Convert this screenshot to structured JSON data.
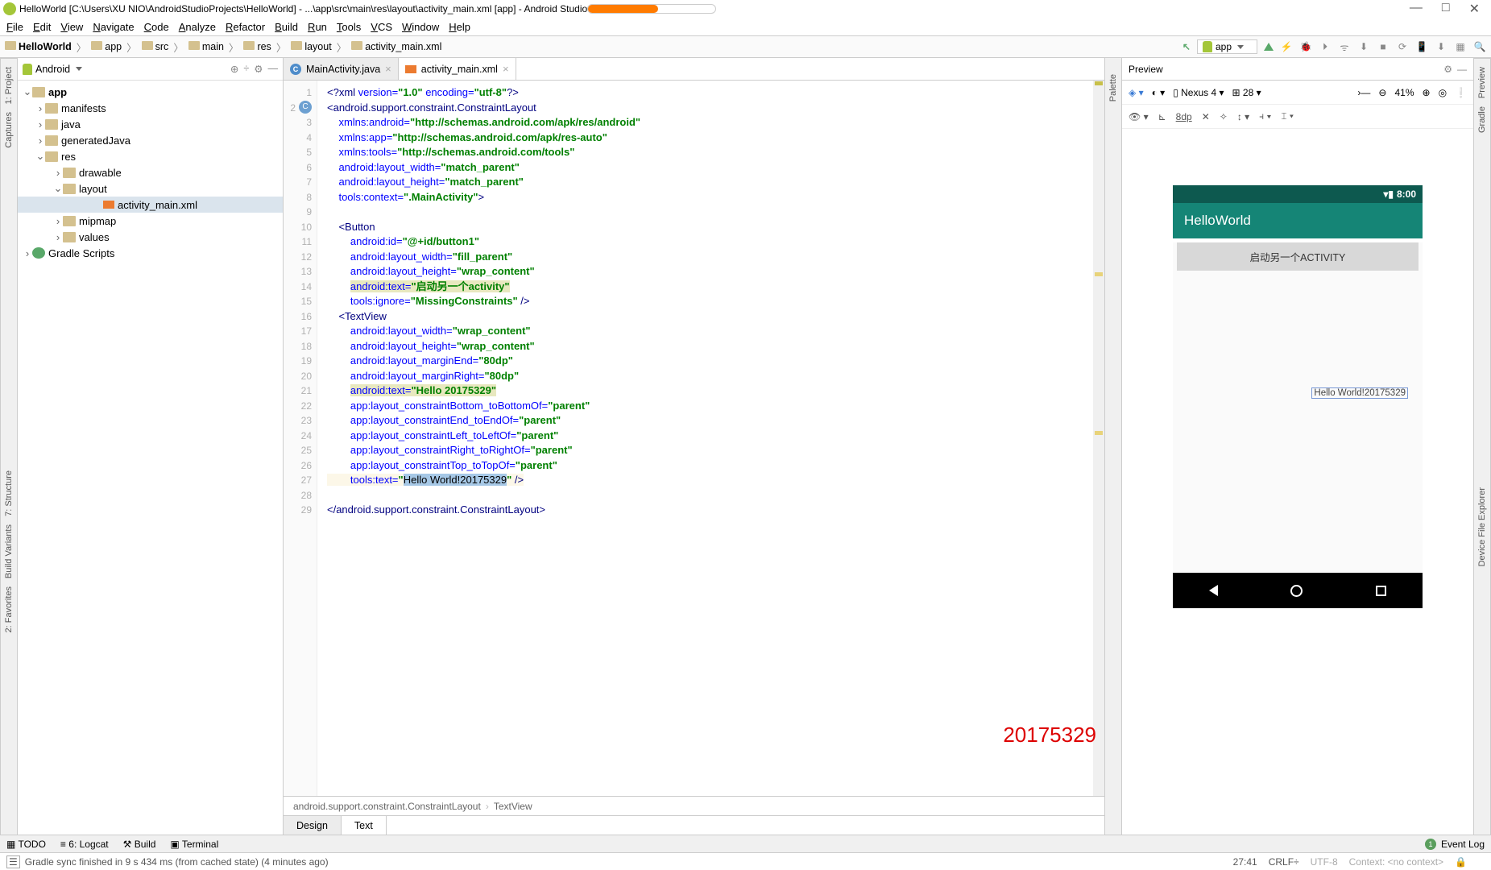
{
  "title": "HelloWorld [C:\\Users\\XU NIO\\AndroidStudioProjects\\HelloWorld] - ...\\app\\src\\main\\res\\layout\\activity_main.xml [app] - Android Studio",
  "menu": [
    "File",
    "Edit",
    "View",
    "Navigate",
    "Code",
    "Analyze",
    "Refactor",
    "Build",
    "Run",
    "Tools",
    "VCS",
    "Window",
    "Help"
  ],
  "crumb": [
    "HelloWorld",
    "app",
    "src",
    "main",
    "res",
    "layout",
    "activity_main.xml"
  ],
  "run_config": "app",
  "project_header": "Android",
  "tree": [
    {
      "d": 0,
      "open": true,
      "icon": "ic",
      "label": "app",
      "bold": true
    },
    {
      "d": 1,
      "open": false,
      "icon": "ic",
      "label": "manifests"
    },
    {
      "d": 1,
      "open": false,
      "icon": "ic",
      "label": "java"
    },
    {
      "d": 1,
      "open": false,
      "icon": "ic",
      "label": "generatedJava"
    },
    {
      "d": 1,
      "open": true,
      "icon": "ic",
      "label": "res"
    },
    {
      "d": 2,
      "open": false,
      "icon": "ic",
      "label": "drawable"
    },
    {
      "d": 2,
      "open": true,
      "icon": "ic",
      "label": "layout"
    },
    {
      "d": 3,
      "open": null,
      "icon": "xml",
      "label": "activity_main.xml",
      "selected": true,
      "indent4": true
    },
    {
      "d": 2,
      "open": false,
      "icon": "ic",
      "label": "mipmap"
    },
    {
      "d": 2,
      "open": false,
      "icon": "ic",
      "label": "values"
    },
    {
      "d": 0,
      "open": false,
      "icon": "gr",
      "label": "Gradle Scripts"
    }
  ],
  "editor_tabs": [
    {
      "icon": "c",
      "label": "MainActivity.java",
      "active": false
    },
    {
      "icon": "x",
      "label": "activity_main.xml",
      "active": true
    }
  ],
  "gutter_lines": 29,
  "code_lines": [
    {
      "html": "<span class='tag'>&lt;?xml </span><span class='attr'>version=</span><span class='str'>\"1.0\"</span> <span class='attr'>encoding=</span><span class='str'>\"utf-8\"</span><span class='tag'>?&gt;</span>"
    },
    {
      "html": "<span class='tag'>&lt;android.support.constraint.ConstraintLayout</span>"
    },
    {
      "html": "    <span class='attr'>xmlns:android=</span><span class='str'>\"http://schemas.android.com/apk/res/android\"</span>"
    },
    {
      "html": "    <span class='attr'>xmlns:app=</span><span class='str'>\"http://schemas.android.com/apk/res-auto\"</span>"
    },
    {
      "html": "    <span class='attr'>xmlns:tools=</span><span class='str'>\"http://schemas.android.com/tools\"</span>"
    },
    {
      "html": "    <span class='attr'>android:layout_width=</span><span class='str'>\"match_parent\"</span>"
    },
    {
      "html": "    <span class='attr'>android:layout_height=</span><span class='str'>\"match_parent\"</span>"
    },
    {
      "html": "    <span class='attr'>tools:context=</span><span class='str'>\".MainActivity\"</span><span class='tag'>&gt;</span>"
    },
    {
      "html": ""
    },
    {
      "html": "    <span class='tag'>&lt;Button</span>"
    },
    {
      "html": "        <span class='attr'>android:id=</span><span class='str'>\"@+id/button1\"</span>"
    },
    {
      "html": "        <span class='attr'>android:layout_width=</span><span class='str'>\"fill_parent\"</span>"
    },
    {
      "html": "        <span class='attr'>android:layout_height=</span><span class='str'>\"wrap_content\"</span>"
    },
    {
      "html": "        <span class='hl'><span class='attr'>android:text=</span><span class='str'>\"启动另一个activity\"</span></span>"
    },
    {
      "html": "        <span class='attr'>tools:ignore=</span><span class='str'>\"MissingConstraints\"</span> <span class='tag'>/&gt;</span>"
    },
    {
      "html": "    <span class='tag'>&lt;TextView</span>"
    },
    {
      "html": "        <span class='attr'>android:layout_width=</span><span class='str'>\"wrap_content\"</span>"
    },
    {
      "html": "        <span class='attr'>android:layout_height=</span><span class='str'>\"wrap_content\"</span>"
    },
    {
      "html": "        <span class='attr'>android:layout_marginEnd=</span><span class='str'>\"80dp\"</span>"
    },
    {
      "html": "        <span class='attr'>android:layout_marginRight=</span><span class='str'>\"80dp\"</span>"
    },
    {
      "html": "        <span class='hl'><span class='attr'>android:text=</span><span class='str'>\"Hello 20175329\"</span></span>"
    },
    {
      "html": "        <span class='attr'>app:layout_constraintBottom_toBottomOf=</span><span class='str'>\"parent\"</span>"
    },
    {
      "html": "        <span class='attr'>app:layout_constraintEnd_toEndOf=</span><span class='str'>\"parent\"</span>"
    },
    {
      "html": "        <span class='attr'>app:layout_constraintLeft_toLeftOf=</span><span class='str'>\"parent\"</span>"
    },
    {
      "html": "        <span class='attr'>app:layout_constraintRight_toRightOf=</span><span class='str'>\"parent\"</span>"
    },
    {
      "html": "        <span class='attr'>app:layout_constraintTop_toTopOf=</span><span class='str'>\"parent\"</span>"
    },
    {
      "html": "<span class='hlcur'>        <span class='attr'>tools:text=</span><span class='str'>\"</span><span class='sel'>Hello World!20175329</span><span class='str'>\"</span> <span class='tag'>/&gt;</span></span>"
    },
    {
      "html": ""
    },
    {
      "html": "<span class='tag'>&lt;/android.support.constraint.ConstraintLayout&gt;</span>"
    }
  ],
  "editor_breadcrumb": [
    "android.support.constraint.ConstraintLayout",
    "TextView"
  ],
  "editor_bottom_tabs": [
    "Design",
    "Text"
  ],
  "red_id": "20175329",
  "palette_label": "Palette",
  "preview": {
    "title": "Preview",
    "device": "Nexus 4",
    "api": "28",
    "zoom": "41%",
    "dp": "8dp",
    "phone": {
      "time": "8:00",
      "app_title": "HelloWorld",
      "button_text": "启动另一个ACTIVITY",
      "textview": "Hello World!20175329"
    }
  },
  "side_left": [
    "1: Project",
    "Captures",
    "7: Structure",
    "Build Variants",
    "2: Favorites"
  ],
  "side_right": [
    "Preview",
    "Gradle",
    "Device File Explorer"
  ],
  "bottom_tools": [
    "TODO",
    "6: Logcat",
    "Build",
    "Terminal"
  ],
  "event_log": "Event Log",
  "status_msg": "Gradle sync finished in 9 s 434 ms (from cached state) (4 minutes ago)",
  "status_right": {
    "pos": "27:41",
    "eol": "CRLF÷",
    "enc": "UTF-8",
    "ctx": "Context: <no context>"
  }
}
